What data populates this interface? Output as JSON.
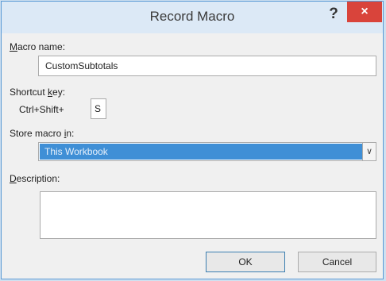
{
  "dialog": {
    "title": "Record Macro",
    "help_icon": "question-mark",
    "close_icon": "close-x",
    "help_glyph": "?",
    "close_glyph": "×"
  },
  "macro_name": {
    "label_mnemonic": "M",
    "label_rest": "acro name:",
    "value": "CustomSubtotals"
  },
  "shortcut": {
    "label_prefix": "Shortcut ",
    "label_mnemonic": "k",
    "label_suffix": "ey:",
    "modifier_text": "Ctrl+Shift+",
    "key_value": "S"
  },
  "store": {
    "label_prefix": "Store macro ",
    "label_mnemonic": "i",
    "label_suffix": "n:",
    "selected": "This Workbook",
    "arrow_glyph": "∨"
  },
  "description": {
    "label_mnemonic": "D",
    "label_rest": "escription:",
    "value": ""
  },
  "buttons": {
    "ok": "OK",
    "cancel": "Cancel"
  },
  "colors": {
    "titlebar": "#dce9f6",
    "close": "#d9443b",
    "selection": "#3f8fd6"
  }
}
